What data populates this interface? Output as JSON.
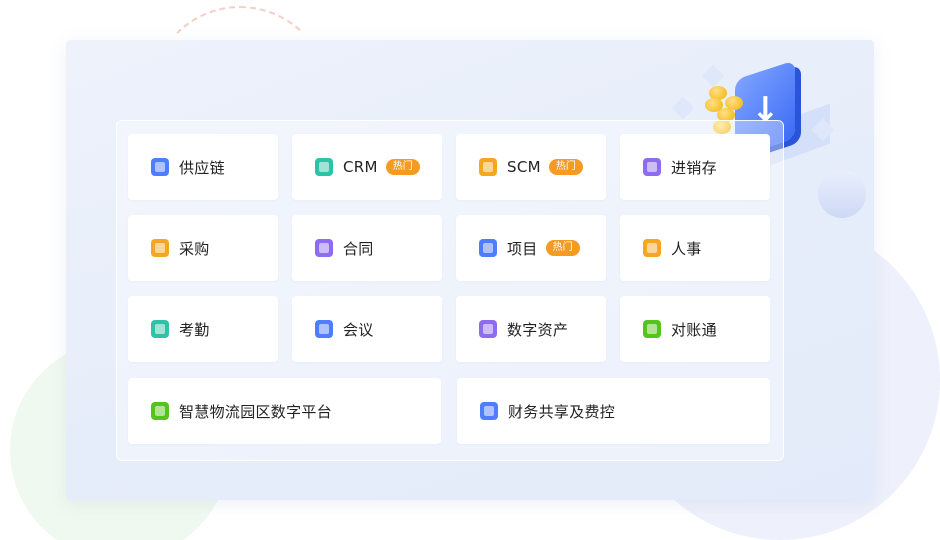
{
  "modules": [
    {
      "label": "供应链",
      "icon": "supply-chain-icon",
      "color": "#4f7dff",
      "hot": false
    },
    {
      "label": "CRM",
      "icon": "crm-icon",
      "color": "#2bc4a6",
      "hot": true
    },
    {
      "label": "SCM",
      "icon": "scm-icon",
      "color": "#f5a623",
      "hot": true
    },
    {
      "label": "进销存",
      "icon": "inventory-icon",
      "color": "#8e6cf0",
      "hot": false
    },
    {
      "label": "采购",
      "icon": "purchase-icon",
      "color": "#f5a623",
      "hot": false
    },
    {
      "label": "合同",
      "icon": "contract-icon",
      "color": "#8e6cf0",
      "hot": false
    },
    {
      "label": "项目",
      "icon": "project-icon",
      "color": "#4f7dff",
      "hot": true
    },
    {
      "label": "人事",
      "icon": "hr-icon",
      "color": "#f5a623",
      "hot": false
    },
    {
      "label": "考勤",
      "icon": "attendance-icon",
      "color": "#2bc4a6",
      "hot": false
    },
    {
      "label": "会议",
      "icon": "meeting-icon",
      "color": "#4f7dff",
      "hot": false
    },
    {
      "label": "数字资产",
      "icon": "digital-asset-icon",
      "color": "#8e6cf0",
      "hot": false
    },
    {
      "label": "对账通",
      "icon": "reconciliation-icon",
      "color": "#52c41a",
      "hot": false
    },
    {
      "label": "智慧物流园区数字平台",
      "icon": "logistics-park-icon",
      "color": "#52c41a",
      "hot": false
    },
    {
      "label": "财务共享及费控",
      "icon": "finance-share-icon",
      "color": "#4f7dff",
      "hot": false
    }
  ],
  "hot_badge_label": "热门"
}
